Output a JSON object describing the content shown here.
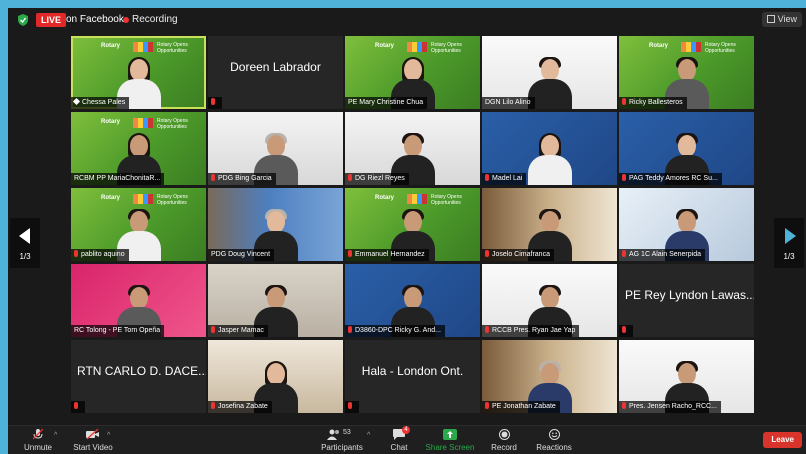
{
  "topbar": {
    "live_badge": "LIVE",
    "live_destination": "on Facebook",
    "recording_label": "Recording",
    "view_label": "View"
  },
  "pagination": {
    "left_page": "1/3",
    "right_page": "1/3"
  },
  "participants": [
    {
      "name": "Chessa Pales",
      "video": true
    },
    {
      "name": "Doreen Labrador",
      "video": false
    },
    {
      "name": "PE Mary Christine Chua",
      "video": true
    },
    {
      "name": "DGN Lilo Alino",
      "video": true
    },
    {
      "name": "Ricky Ballesteros",
      "video": true
    },
    {
      "name": "RCBM PP MariaChonitaR...",
      "video": true
    },
    {
      "name": "PDG Bing Garcia",
      "video": true
    },
    {
      "name": "DG Riezl Reyes",
      "video": true
    },
    {
      "name": "Madel Lai",
      "video": true
    },
    {
      "name": "PAG Teddy Amores RC Su...",
      "video": true
    },
    {
      "name": "pablito aquino",
      "video": true
    },
    {
      "name": "PDG Doug Vincent",
      "video": true
    },
    {
      "name": "Emmanuel Hernandez",
      "video": true
    },
    {
      "name": "Joselo Cimafranca",
      "video": true
    },
    {
      "name": "AG 1C Alain Senerpida",
      "video": true
    },
    {
      "name": "RC Tolong - PE Tom Opeña",
      "video": true
    },
    {
      "name": "Jasper Mamac",
      "video": true
    },
    {
      "name": "D3860-DPC Ricky G. And...",
      "video": true
    },
    {
      "name": "RCCB Pres. Ryan Jae Yap",
      "video": true
    },
    {
      "name": "PE Rey Lyndon Lawas...",
      "video": false
    },
    {
      "name": "RTN CARLO D. DACE...",
      "video": false
    },
    {
      "name": "Josefina Zabate",
      "video": true
    },
    {
      "name": "Hala - London Ont.",
      "video": false
    },
    {
      "name": "PE Jonathan Zabate",
      "video": true
    },
    {
      "name": "Pres. Jensen Racho_RCC...",
      "video": true
    }
  ],
  "toolbar": {
    "unmute": "Unmute",
    "start_video": "Start Video",
    "participants": "Participants",
    "participants_count": "53",
    "chat": "Chat",
    "chat_badge": "4",
    "share_screen": "Share Screen",
    "record": "Record",
    "reactions": "Reactions",
    "leave": "Leave"
  },
  "backgrounds": {
    "rotary_top_left": "Rotary",
    "rotary_top_right": "Rotary Opens Opportunities"
  },
  "colors": {
    "live": "#e02828",
    "active_speaker": "#c9e05a",
    "share_screen": "#2ba84a",
    "leave": "#d9342b",
    "page_background": "#4fb3d9"
  }
}
